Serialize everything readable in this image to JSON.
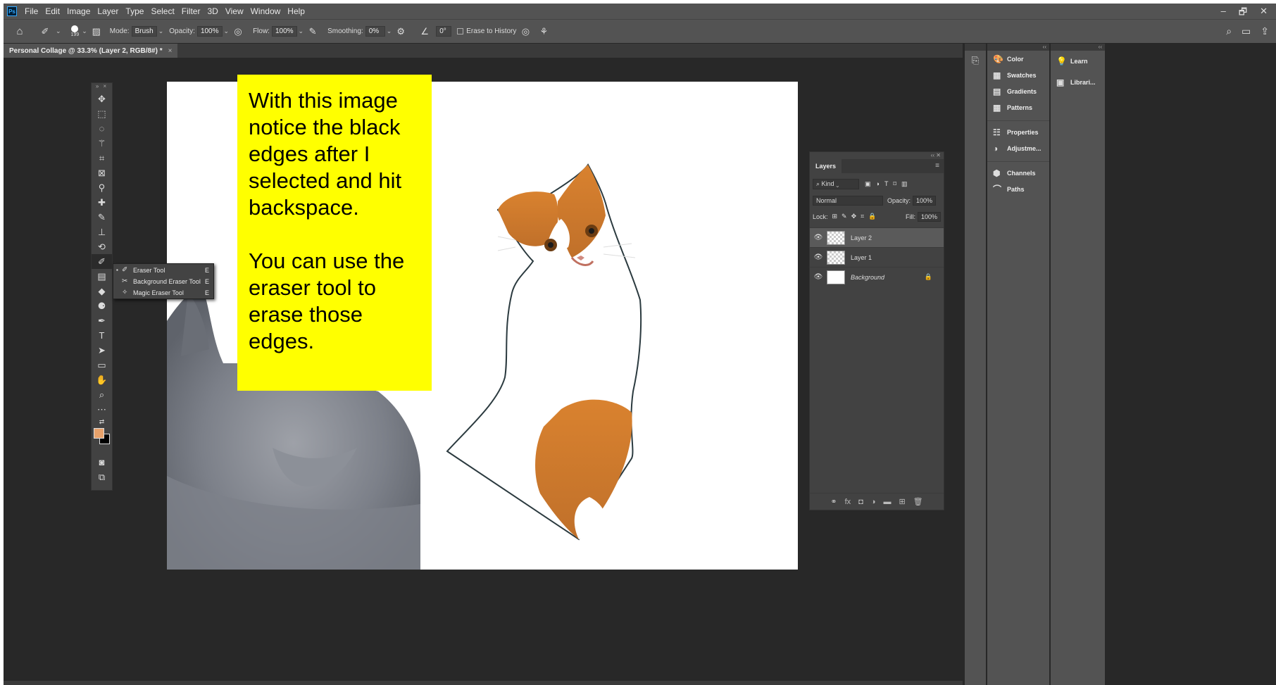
{
  "menubar": {
    "logo": "Ps",
    "items": [
      "File",
      "Edit",
      "Image",
      "Layer",
      "Type",
      "Select",
      "Filter",
      "3D",
      "View",
      "Window",
      "Help"
    ],
    "window_controls": [
      "–",
      "🗗",
      "✕"
    ]
  },
  "options": {
    "brush_size": "199",
    "mode_label": "Mode:",
    "mode_value": "Brush",
    "opacity_label": "Opacity:",
    "opacity_value": "100%",
    "flow_label": "Flow:",
    "flow_value": "100%",
    "smoothing_label": "Smoothing:",
    "smoothing_value": "0%",
    "angle_value": "0°",
    "erase_history_label": "Erase to History"
  },
  "document": {
    "tab_title": "Personal Collage @ 33.3% (Layer 2, RGB/8#) *",
    "close": "×"
  },
  "tool_flyout": {
    "items": [
      {
        "label": "Eraser Tool",
        "key": "E",
        "selected": true
      },
      {
        "label": "Background Eraser Tool",
        "key": "E",
        "selected": false
      },
      {
        "label": "Magic Eraser Tool",
        "key": "E",
        "selected": false
      }
    ]
  },
  "note": {
    "paragraph1": "With this image notice the black edges after I selected and hit backspace.",
    "paragraph2": "You can use the eraser tool to erase those edges."
  },
  "layers_panel": {
    "tab": "Layers",
    "filter_label": "Kind",
    "blend_mode": "Normal",
    "opacity_label": "Opacity:",
    "opacity_value": "100%",
    "lock_label": "Lock:",
    "fill_label": "Fill:",
    "fill_value": "100%",
    "layers": [
      {
        "name": "Layer 2",
        "selected": true
      },
      {
        "name": "Layer 1",
        "selected": false
      },
      {
        "name": "Background",
        "selected": false
      }
    ]
  },
  "dock": {
    "group1": [
      "Color",
      "Swatches",
      "Gradients",
      "Patterns"
    ],
    "group2": [
      "Properties",
      "Adjustme..."
    ],
    "group3": [
      "Channels",
      "Paths"
    ],
    "group4": [
      "Learn",
      "Librari..."
    ]
  },
  "colors": {
    "foreground": "#e8a26b",
    "background": "#000000",
    "note_bg": "#ffff00"
  }
}
